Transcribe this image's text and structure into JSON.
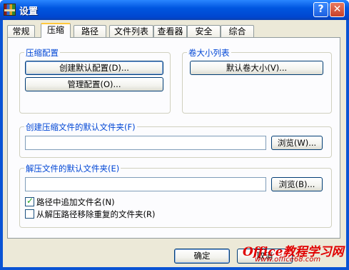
{
  "window": {
    "title": "设置"
  },
  "tabs": [
    {
      "label": "常规"
    },
    {
      "label": "压缩"
    },
    {
      "label": "路径"
    },
    {
      "label": "文件列表"
    },
    {
      "label": "查看器"
    },
    {
      "label": "安全"
    },
    {
      "label": "综合"
    }
  ],
  "active_tab": "压缩",
  "compression_group": {
    "title": "压缩配置",
    "create_default_button": "创建默认配置(D)...",
    "manage_button": "管理配置(O)..."
  },
  "volume_group": {
    "title": "卷大小列表",
    "default_volume_button": "默认卷大小(V)..."
  },
  "default_archive_folder": {
    "title": "创建压缩文件的默认文件夹(F)",
    "value": "",
    "browse_button": "浏览(W)..."
  },
  "extract_folder": {
    "title": "解压文件的默认文件夹(E)",
    "value": "",
    "browse_button": "浏览(B)...",
    "append_name_checkbox": {
      "label": "路径中追加文件名(N)",
      "checked": true
    },
    "remove_redundant_checkbox": {
      "label": "从解压路径移除重复的文件夹(R)",
      "checked": false
    }
  },
  "footer": {
    "ok_button": "确定",
    "cancel_button": "取消"
  },
  "watermark": {
    "line1": "Office教程学习网",
    "line2": "www.office68.com"
  }
}
